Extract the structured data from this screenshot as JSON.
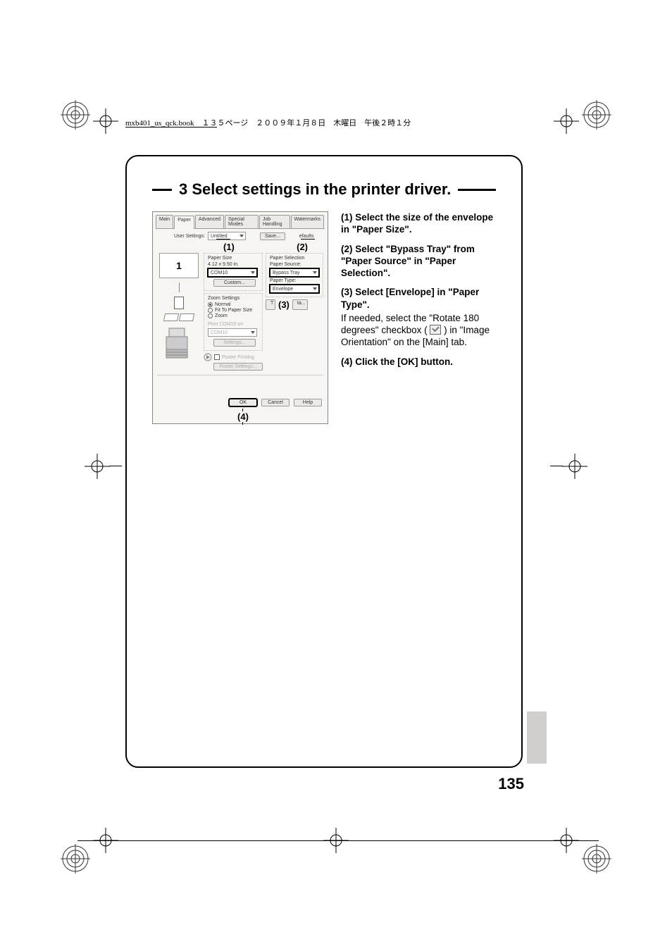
{
  "header": {
    "book_name": "mxb401_us_qck.book",
    "page_info": "１３５ページ",
    "date": "２００９年１月８日",
    "weekday": "木曜日",
    "time": "午後２時１分"
  },
  "step": {
    "number": "3",
    "title": "Select settings in the printer driver."
  },
  "dialog": {
    "tabs": [
      "Main",
      "Paper",
      "Advanced",
      "Special Modes",
      "Job Handling",
      "Watermarks"
    ],
    "active_tab": "Paper",
    "user_settings_label": "User Settings:",
    "user_settings_value": "Untitled",
    "save_btn": "Save...",
    "efaults_btn": "efaults",
    "paper_size_label": "Paper Size",
    "paper_size_dim": "4.12 x 9.50 in.",
    "paper_size_value": "COM10",
    "custom_btn": "Custom...",
    "zoom_label": "Zoom Settings",
    "zoom_normal": "Normal",
    "zoom_fit": "Fit To Paper Size",
    "zoom_zoom": "Zoom",
    "print_on_label": "Print COM10 on",
    "print_on_value": "COM10",
    "settings_btn": "Settings...",
    "poster_label": "Poster Printing",
    "poster_btn": "Poster Settings...",
    "paper_selection_label": "Paper Selection",
    "paper_source_label": "Paper Source:",
    "paper_source_value": "Bypass Tray",
    "paper_type_label": "Paper Type:",
    "paper_type_value": "Envelope",
    "tray_btn_left": "T",
    "tray_btn_right": "ta...",
    "ok_btn": "OK",
    "cancel_btn": "Cancel",
    "help_btn": "Help",
    "callouts": {
      "one": "(1)",
      "two": "(2)",
      "three": "(3)",
      "four": "(4)"
    },
    "preview_digit": "1"
  },
  "instructions": {
    "i1_num": "(1)",
    "i1_head": "Select the size of the envelope in \"Paper Size\".",
    "i2_num": "(2)",
    "i2_head": "Select \"Bypass Tray\" from \"Paper Source\" in \"Paper Selection\".",
    "i3_num": "(3)",
    "i3_head": "Select [Envelope] in \"Paper Type\".",
    "i3_body_a": "If needed, select the \"Rotate 180 degrees\" checkbox (",
    "i3_body_b": ") in \"Image Orientation\" on the [Main] tab.",
    "i4_num": "(4)",
    "i4_head": "Click the [OK] button."
  },
  "page_number": "135"
}
